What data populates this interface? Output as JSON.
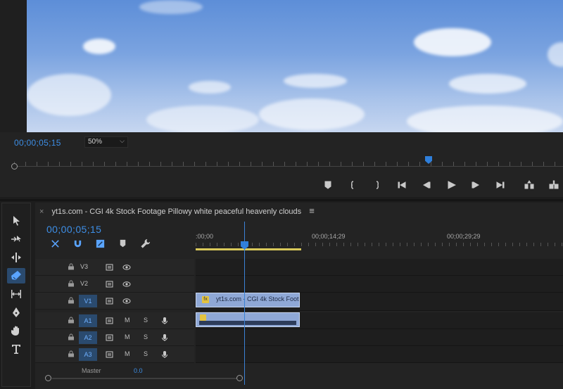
{
  "monitor": {
    "timecode": "00;00;05;15",
    "zoom": "50%"
  },
  "timeline": {
    "sequence_name": "yt1s.com - CGI 4k Stock Footage  Pillowy white peaceful heavenly clouds",
    "close_glyph": "×",
    "menu_glyph": "≡",
    "timecode": "00;00;05;15",
    "ruler_labels": [
      ":00;00",
      "00;00;14;29",
      "00;00;29;29"
    ],
    "tracks": [
      {
        "name": "V3",
        "type": "video"
      },
      {
        "name": "V2",
        "type": "video"
      },
      {
        "name": "V1",
        "type": "video",
        "source": true
      },
      {
        "name": "A1",
        "type": "audio",
        "source": "A1"
      },
      {
        "name": "A2",
        "type": "audio",
        "source": "A2"
      },
      {
        "name": "A3",
        "type": "audio",
        "source": "A3"
      }
    ],
    "mute_label": "M",
    "solo_label": "S",
    "video_clip_label": "yt1s.com - CGI 4k Stock Foot",
    "fx_label": "fx",
    "master_label": "Master",
    "master_value": "0.0"
  },
  "colors": {
    "accent": "#3d8ee6",
    "clip": "#8fa8d6",
    "work_area": "#d9c95a",
    "track_source": "#2a4a6e"
  },
  "icons": {
    "tools": [
      "selection-tool-icon",
      "track-select-tool-icon",
      "ripple-edit-tool-icon",
      "razor-tool-icon",
      "slip-tool-icon",
      "pen-tool-icon",
      "hand-tool-icon",
      "type-tool-icon"
    ],
    "transport": [
      "add-marker-icon",
      "mark-in-icon",
      "mark-out-icon",
      "go-to-in-icon",
      "step-back-icon",
      "play-icon",
      "step-forward-icon",
      "go-to-out-icon",
      "lift-icon",
      "extract-icon"
    ]
  }
}
